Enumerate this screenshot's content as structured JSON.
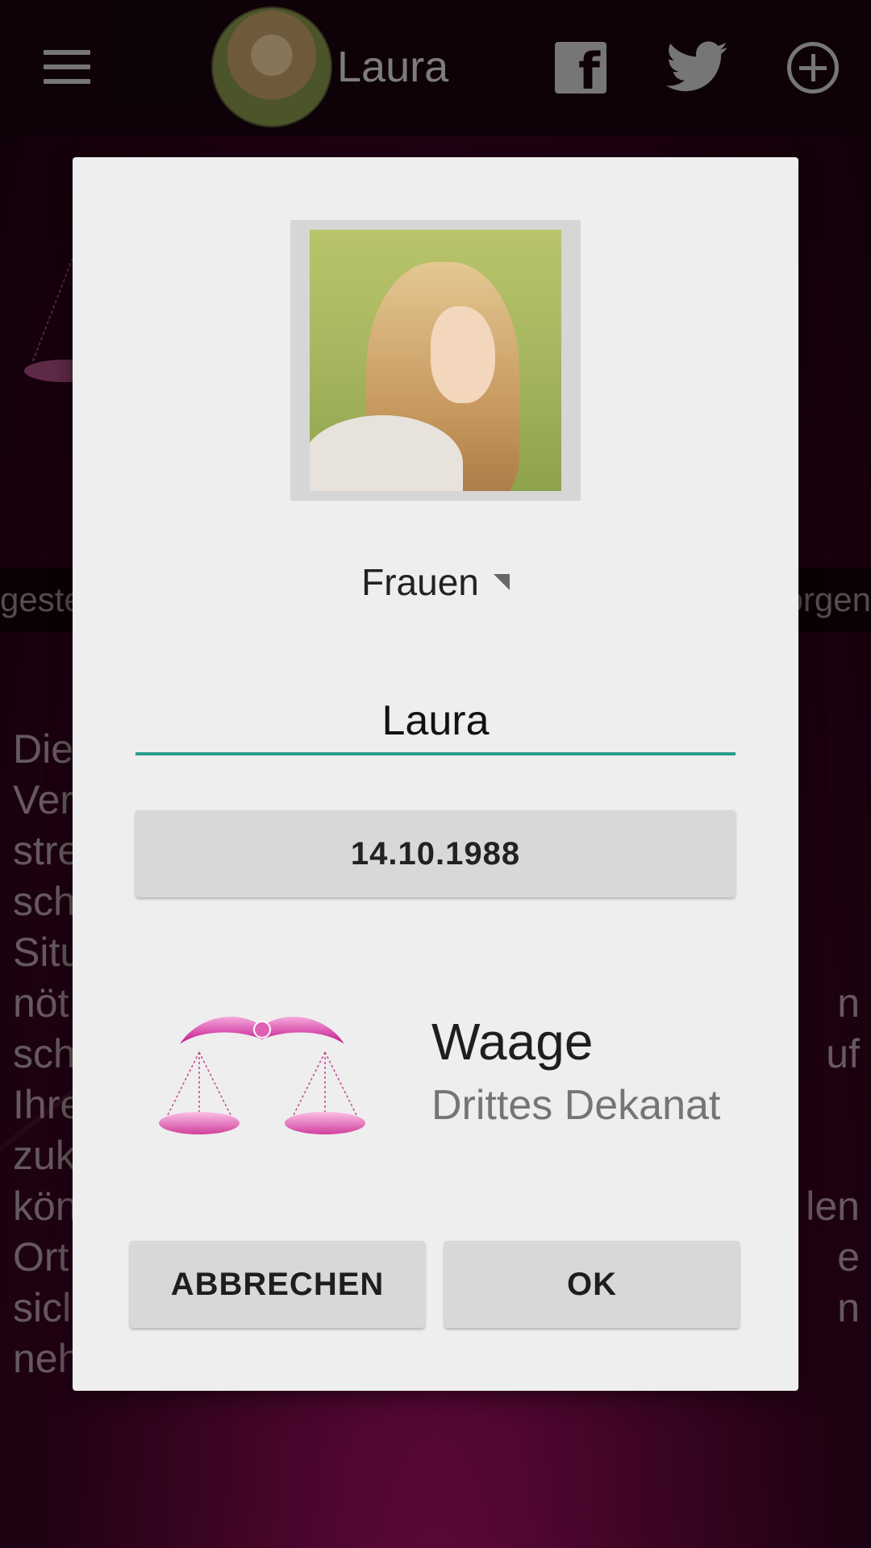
{
  "topbar": {
    "user_name": "Laura",
    "icons": [
      "menu-icon",
      "avatar",
      "facebook-icon",
      "twitter-icon",
      "add-circle-icon"
    ]
  },
  "daybar": {
    "left_label": "geste",
    "right_label": "orgen"
  },
  "background_text": {
    "left_fragments": [
      "Die",
      "Ver",
      "stre",
      "sch",
      "Situ",
      "nöt",
      "sch",
      "Ihre",
      "zuk",
      "kön",
      "Ort",
      "sicl",
      "neh"
    ],
    "right_fragments": [
      "",
      "",
      "",
      "",
      "",
      "n",
      "uf",
      "",
      "",
      "len",
      "e",
      "n",
      ""
    ]
  },
  "dialog": {
    "gender_spinner_value": "Frauen",
    "name_value": "Laura",
    "date_label": "14.10.1988",
    "zodiac_sign": "Waage",
    "zodiac_decan": "Drittes Dekanat",
    "cancel_label": "ABBRECHEN",
    "ok_label": "OK"
  },
  "colors": {
    "accent_underline": "#2a9d8f",
    "zodiac_pink": "#e040a8",
    "dialog_bg": "#eeeeee",
    "button_bg": "#d8d8d8"
  }
}
